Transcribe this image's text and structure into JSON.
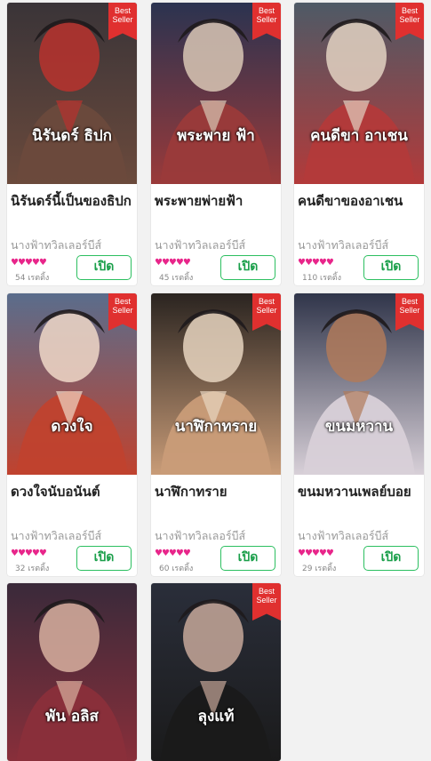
{
  "badge_text": "Best Seller",
  "books": [
    {
      "title": "นิรันดร์นี้เป็นของธิปก",
      "author": "นางฟ้าทวิลเลอร์บีส์",
      "hearts": "♥♥♥♥♥",
      "rating": "54 เรตติ้ง",
      "button": "เปิด",
      "best_seller": true,
      "cover_text": "นิรันดร์ ธิปก",
      "palette": [
        "#3a3438",
        "#6b4a3c",
        "#b8322e"
      ]
    },
    {
      "title": "พระพายพ่ายฟ้า",
      "author": "นางฟ้าทวิลเลอร์บีส์",
      "hearts": "♥♥♥♥♥",
      "rating": "45 เรตติ้ง",
      "button": "เปิด",
      "best_seller": true,
      "cover_text": "พระพาย ฟ้า",
      "palette": [
        "#2b3350",
        "#9a3a3a",
        "#d9c7b5"
      ]
    },
    {
      "title": "คนดีขาของอาเชน",
      "author": "นางฟ้าทวิลเลอร์บีส์",
      "hearts": "♥♥♥♥♥",
      "rating": "110 เรตติ้ง",
      "button": "เปิด",
      "best_seller": true,
      "cover_text": "คนดีขา อาเชน",
      "palette": [
        "#4e5a66",
        "#b33a3a",
        "#e3d2c2"
      ]
    },
    {
      "title": "ดวงใจนับอนันต์",
      "author": "นางฟ้าทวิลเลอร์บีส์",
      "hearts": "♥♥♥♥♥",
      "rating": "32 เรตติ้ง",
      "button": "เปิด",
      "best_seller": true,
      "cover_text": "ดวงใจ",
      "palette": [
        "#5a6d8c",
        "#c0422e",
        "#f0d8c8"
      ]
    },
    {
      "title": "นาฬิกาทราย",
      "author": "นางฟ้าทวิลเลอร์บีส์",
      "hearts": "♥♥♥♥♥",
      "rating": "60 เรตติ้ง",
      "button": "เปิด",
      "best_seller": true,
      "cover_text": "นาฬิกาทราย",
      "palette": [
        "#2a2420",
        "#c99c78",
        "#e8d5c0"
      ]
    },
    {
      "title": "ขนมหวานเพลย์บอย",
      "author": "นางฟ้าทวิลเลอร์บีส์",
      "hearts": "♥♥♥♥♥",
      "rating": "29 เรตติ้ง",
      "button": "เปิด",
      "best_seller": true,
      "cover_text": "ขนมหวาน",
      "palette": [
        "#30354a",
        "#d8d0d8",
        "#b07a5a"
      ]
    },
    {
      "title": "",
      "author": "",
      "hearts": "",
      "rating": "",
      "button": "",
      "best_seller": false,
      "cover_text": "พัน อลิส",
      "palette": [
        "#3a2a3a",
        "#8a2f3a",
        "#d8b0a0"
      ]
    },
    {
      "title": "",
      "author": "",
      "hearts": "",
      "rating": "",
      "button": "",
      "best_seller": true,
      "cover_text": "ลุงแท้",
      "palette": [
        "#2a2e3a",
        "#1a1a1a",
        "#c7a89a"
      ]
    }
  ]
}
